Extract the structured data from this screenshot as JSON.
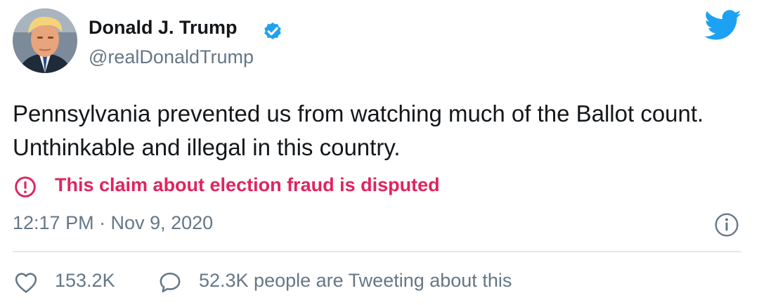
{
  "author": {
    "name": "Donald J. Trump",
    "handle": "@realDonaldTrump",
    "verified": true,
    "avatar_icon": "profile-photo"
  },
  "tweet": {
    "text": "Pennsylvania prevented us from watching much of the Ballot count. Unthinkable and illegal in this country."
  },
  "label": {
    "icon": "exclamation-circle-icon",
    "text": "This claim about election fraud is disputed",
    "color": "#e0245e"
  },
  "meta": {
    "timestamp": "12:17 PM · Nov 9, 2020",
    "info_icon": "info-icon"
  },
  "engagement": {
    "like_icon": "heart-icon",
    "likes": "153.2K",
    "reply_icon": "speech-bubble-icon",
    "conversation": "52.3K people are Tweeting about this"
  },
  "colors": {
    "text_primary": "#14171a",
    "text_secondary": "#657786",
    "brand_blue": "#1da1f2",
    "divider": "#e1e8ed"
  },
  "brand_icon": "twitter-bird-icon"
}
